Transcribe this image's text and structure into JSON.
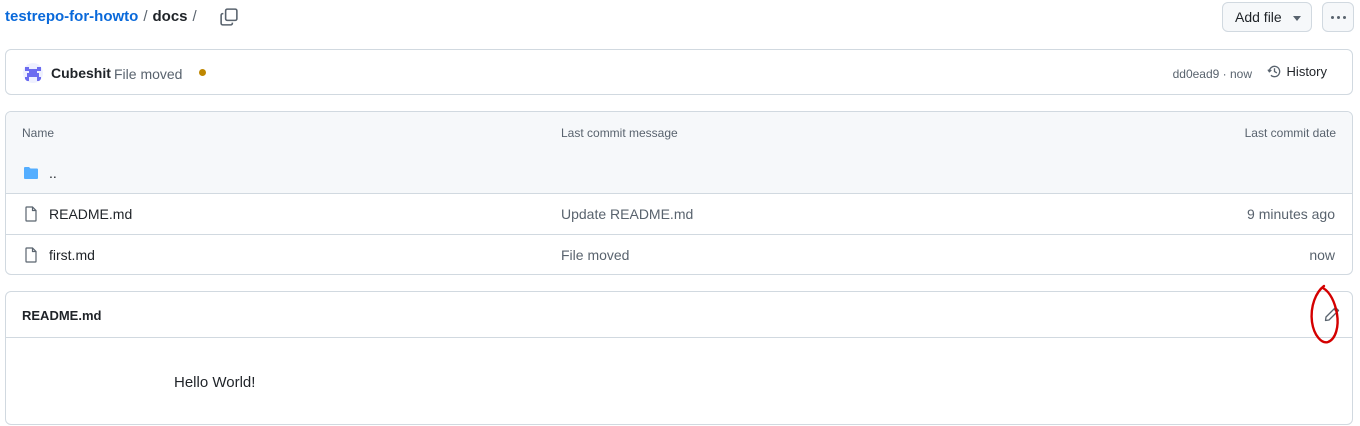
{
  "breadcrumb": {
    "repo": "testrepo-for-howto",
    "sep1": "/",
    "folder": "docs",
    "sep2": "/"
  },
  "toolbar": {
    "add_file_label": "Add file",
    "more_icon": "kebab-horizontal-icon",
    "copy_icon": "copy-icon"
  },
  "commit": {
    "author": "Cubeshit",
    "message": "File moved",
    "status_color": "#bf8700",
    "sha_time": "dd0ead9 · now",
    "history_label": "History"
  },
  "table": {
    "headers": {
      "name": "Name",
      "message": "Last commit message",
      "date": "Last commit date"
    },
    "parent_label": "..",
    "rows": [
      {
        "name": "README.md",
        "message": "Update README.md",
        "date": "9 minutes ago"
      },
      {
        "name": "first.md",
        "message": "File moved",
        "date": "now"
      }
    ]
  },
  "readme": {
    "title": "README.md",
    "content": "Hello World!",
    "edit_icon": "pencil-icon"
  },
  "colors": {
    "link": "#0969da",
    "annotation": "#d40000",
    "folder": "#54aeff"
  }
}
